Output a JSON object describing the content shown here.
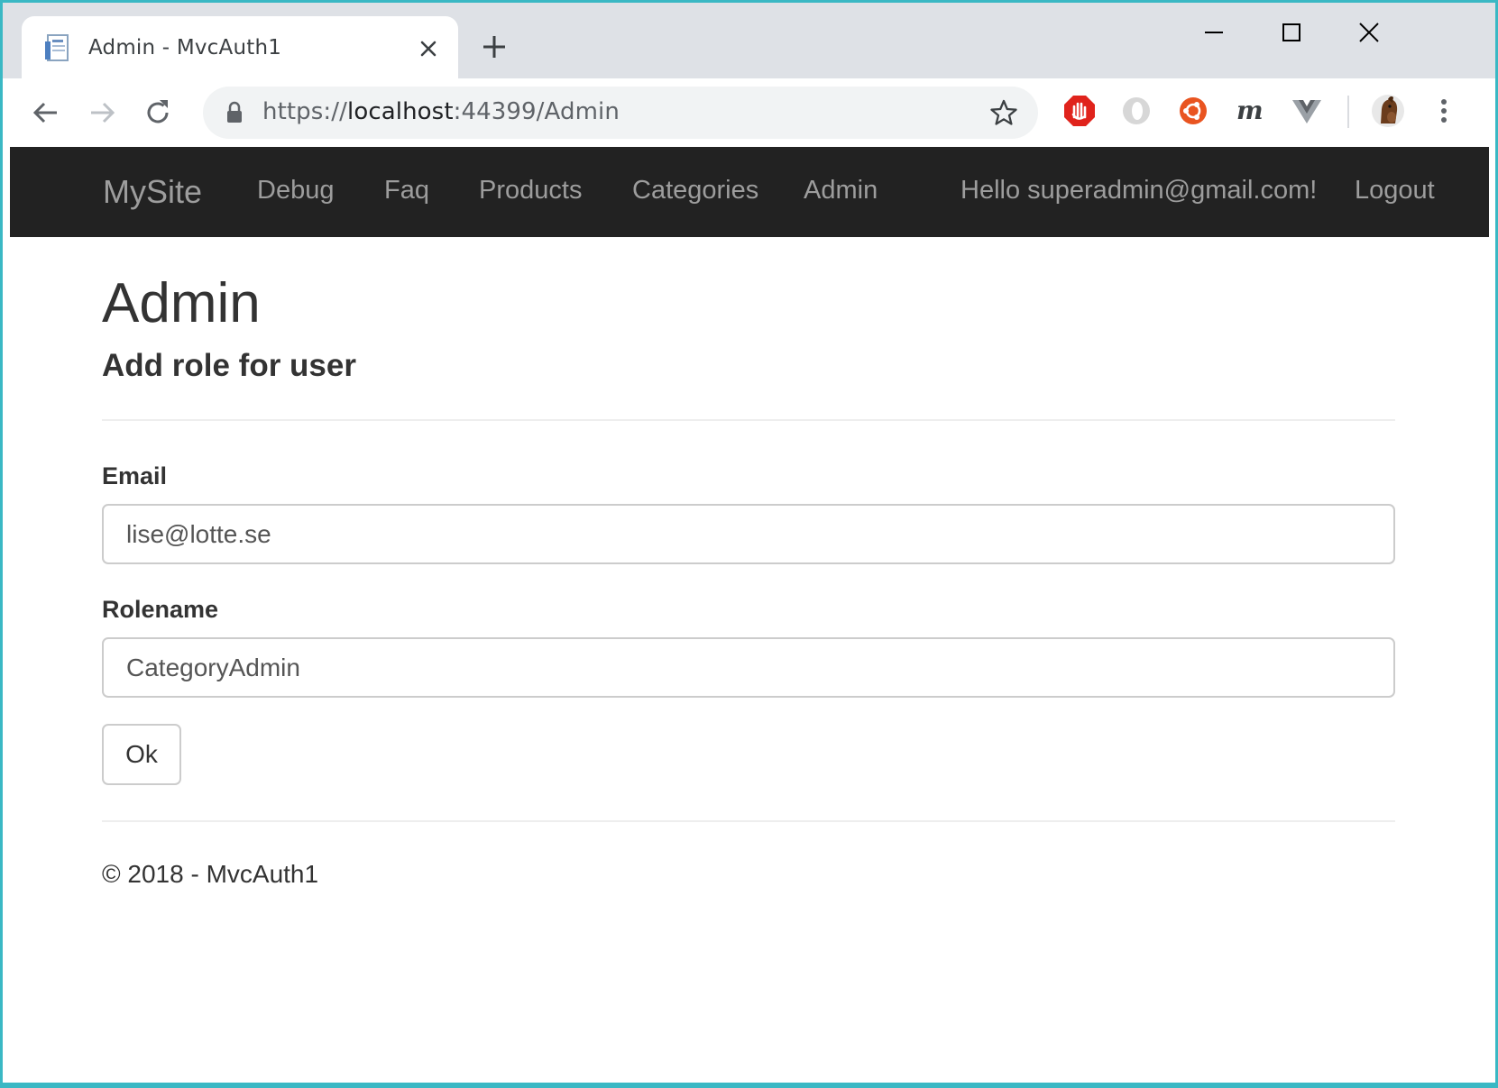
{
  "browser": {
    "tab_title": "Admin - MvcAuth1",
    "url_scheme": "https://",
    "url_host": "localhost",
    "url_rest": ":44399/Admin",
    "icons": [
      "page-favicon",
      "close-icon",
      "plus-icon",
      "minimize-icon",
      "maximize-icon",
      "window-close-icon",
      "back-arrow-icon",
      "forward-arrow-icon",
      "reload-icon",
      "lock-icon",
      "star-icon",
      "adblock-icon",
      "extension-icon",
      "ubuntu-icon",
      "m-extension-icon",
      "vue-devtools-icon",
      "profile-avatar",
      "kebab-menu-icon"
    ]
  },
  "navbar": {
    "brand": "MySite",
    "links": [
      "Debug",
      "Faq",
      "Products",
      "Categories",
      "Admin"
    ],
    "greeting": "Hello superadmin@gmail.com!",
    "logout": "Logout",
    "bg_color": "#222222",
    "text_color": "#9d9d9d"
  },
  "main": {
    "title": "Admin",
    "subtitle": "Add role for user",
    "email_label": "Email",
    "email_value": "lise@lotte.se",
    "rolename_label": "Rolename",
    "rolename_value": "CategoryAdmin",
    "submit_label": "Ok"
  },
  "footer": {
    "text": "© 2018 - MvcAuth1"
  }
}
